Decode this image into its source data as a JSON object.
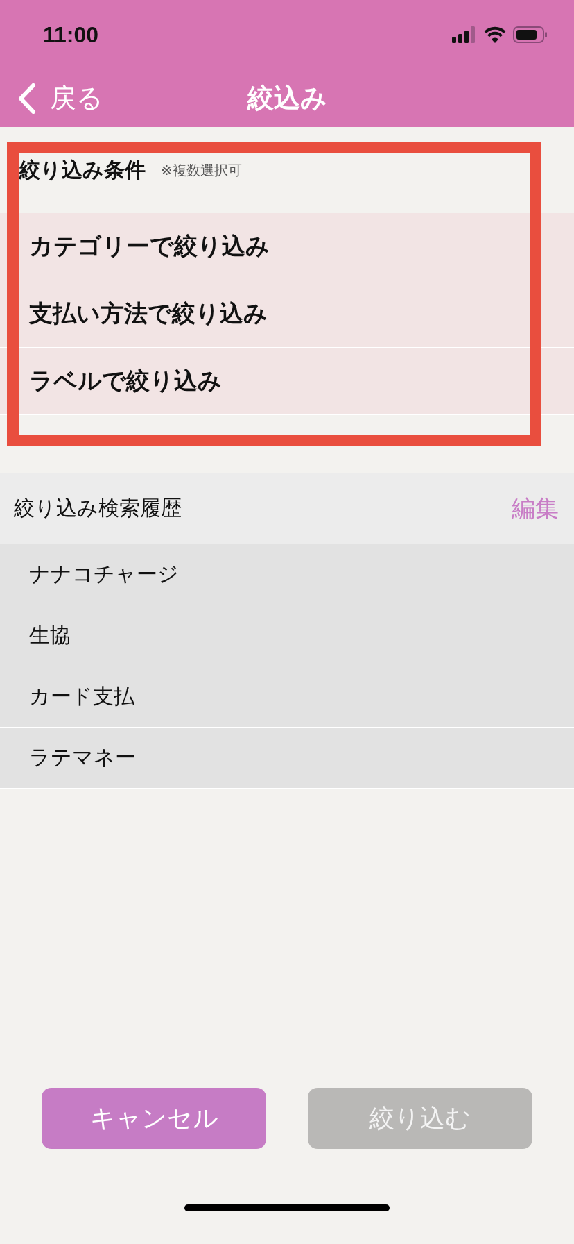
{
  "status_bar": {
    "time": "11:00"
  },
  "nav": {
    "back": "戻る",
    "title": "絞込み"
  },
  "conditions": {
    "title": "絞り込み条件",
    "note": "※複数選択可",
    "items": [
      {
        "label": "カテゴリーで絞り込み"
      },
      {
        "label": "支払い方法で絞り込み"
      },
      {
        "label": "ラベルで絞り込み"
      }
    ]
  },
  "history": {
    "title": "絞り込み検索履歴",
    "edit": "編集",
    "items": [
      {
        "label": "ナナコチャージ"
      },
      {
        "label": "生協"
      },
      {
        "label": "カード支払"
      },
      {
        "label": "ラテマネー"
      }
    ]
  },
  "buttons": [
    {
      "label": "キャンセル",
      "disabled": false
    },
    {
      "label": "絞り込む",
      "disabled": true
    }
  ],
  "annotation": {
    "kind": "highlight"
  }
}
